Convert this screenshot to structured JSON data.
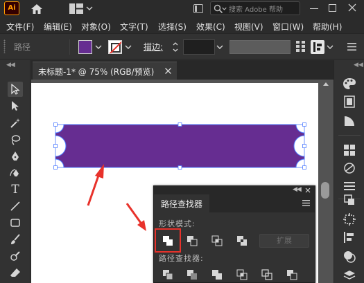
{
  "app": {
    "logo_text": "Ai",
    "search_placeholder": "搜索 Adobe 帮助"
  },
  "menu": {
    "items": [
      "文件(F)",
      "编辑(E)",
      "对象(O)",
      "文字(T)",
      "选择(S)",
      "效果(C)",
      "视图(V)",
      "窗口(W)",
      "帮助(H)"
    ]
  },
  "control": {
    "selection_label": "路径",
    "fill_color": "#662d91",
    "stroke_label": "描边:"
  },
  "document": {
    "tab_title": "未标题-1* @ 75% (RGB/预览)"
  },
  "artwork": {
    "shape_fill": "#662d91",
    "selection_color": "#4f7cff"
  },
  "pathfinder": {
    "panel_title": "路径查找器",
    "shape_modes_label": "形状模式:",
    "pathfinders_label": "路径查找器:",
    "expand_label": "扩展",
    "shape_modes": [
      "unite-icon",
      "minus-front-icon",
      "intersect-icon",
      "exclude-icon"
    ],
    "annotation_color": "#e8322b"
  }
}
